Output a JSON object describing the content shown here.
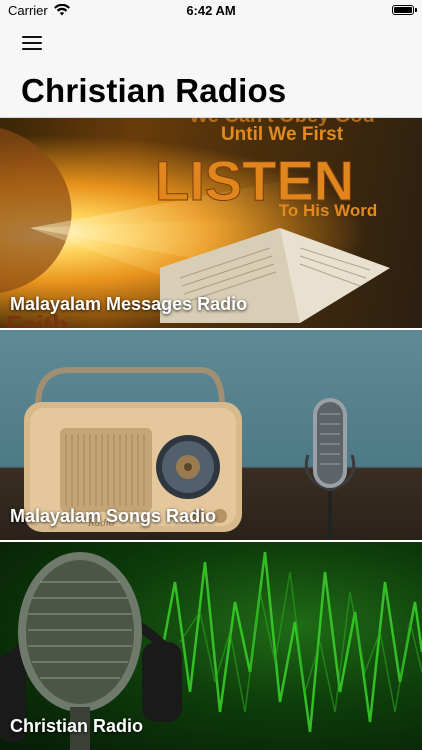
{
  "status_bar": {
    "carrier": "Carrier",
    "time": "6:42 AM",
    "wifi_icon": "wifi-icon",
    "battery_icon": "battery-icon"
  },
  "header": {
    "menu_icon": "hamburger-menu-icon",
    "title": "Christian Radios"
  },
  "stations": [
    {
      "label": "Malayalam Messages Radio",
      "image_text": {
        "line1": "We Can't Obey God",
        "line2": "Until We First",
        "big": "LISTEN",
        "line3": "To His Word",
        "partial": "Faith"
      }
    },
    {
      "label": "Malayalam Songs Radio",
      "image_text": {
        "brand": "Radio"
      }
    },
    {
      "label": "Christian Radio"
    }
  ]
}
